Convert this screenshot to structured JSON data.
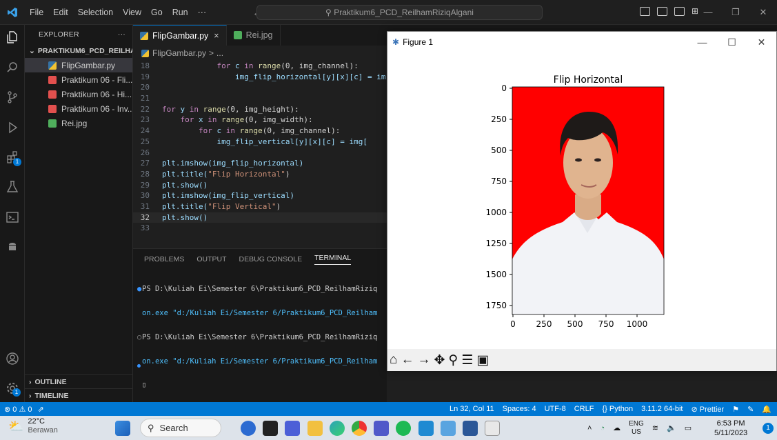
{
  "titlebar": {
    "menu": [
      "File",
      "Edit",
      "Selection",
      "View",
      "Go",
      "Run",
      "···"
    ],
    "search_text": "Praktikum6_PCD_ReilhamRiziqAlgani"
  },
  "activity_badges": {
    "extensions": "1",
    "accounts": "1"
  },
  "explorer": {
    "header": "EXPLORER",
    "more": "···",
    "folder": "PRAKTIKUM6_PCD_REILHA...",
    "files": [
      {
        "name": "FlipGambar.py",
        "color": "#f1c232"
      },
      {
        "name": "Praktikum 06 - Fli...",
        "color": "#e2504e"
      },
      {
        "name": "Praktikum 06 - Hi...",
        "color": "#e2504e"
      },
      {
        "name": "Praktikum 06 - Inv...",
        "color": "#e2504e"
      },
      {
        "name": "Rei.jpg",
        "color": "#4fae5c"
      }
    ],
    "outline": "OUTLINE",
    "timeline": "TIMELINE"
  },
  "editor": {
    "tabs": [
      {
        "label": "FlipGambar.py",
        "close": "×"
      },
      {
        "label": "Rei.jpg"
      }
    ],
    "breadcrumb": [
      "FlipGambar.py",
      ">",
      "..."
    ],
    "lines": [
      "18",
      "19",
      "20",
      "21",
      "22",
      "23",
      "24",
      "25",
      "26",
      "27",
      "28",
      "29",
      "30",
      "31",
      "32",
      "33"
    ],
    "code": {
      "l18_for": "for",
      "l18_c": "c",
      "l18_in": "in",
      "l18_range": "range",
      "l18_args": "(0, img_channel):",
      "l19": "img_flip_horizontal[y][x][c] = im",
      "l22_for": "for",
      "l22_y": "y",
      "l22_in": "in",
      "l22_range": "range",
      "l22_args": "(0, img_height):",
      "l23_for": "for",
      "l23_x": "x",
      "l23_in": "in",
      "l23_range": "range",
      "l23_args": "(0, img_width):",
      "l24_for": "for",
      "l24_c": "c",
      "l24_in": "in",
      "l24_range": "range",
      "l24_args": "(0, img_channel):",
      "l25": "img_flip_vertical[y][x][c] = img[",
      "l27": "plt.imshow(img_flip_horizontal)",
      "l28_a": "plt.title(",
      "l28_s": "\"Flip Horizontal\"",
      "l28_b": ")",
      "l29": "plt.show()",
      "l30": "plt.imshow(img_flip_vertical)",
      "l31_a": "plt.title(",
      "l31_s": "\"Flip Vertical\"",
      "l31_b": ")",
      "l32": "plt.show()"
    }
  },
  "panel": {
    "tabs": [
      "PROBLEMS",
      "OUTPUT",
      "DEBUG CONSOLE",
      "TERMINAL"
    ],
    "terminal": [
      "PS D:\\Kuliah Ei\\Semester 6\\Praktikum6_PCD_ReilhamRiziq",
      "on.exe \"d:/Kuliah Ei/Semester 6/Praktikum6_PCD_Reilham",
      "PS D:\\Kuliah Ei\\Semester 6\\Praktikum6_PCD_ReilhamRiziq",
      "on.exe \"d:/Kuliah Ei/Semester 6/Praktikum6_PCD_Reilham"
    ],
    "cursor": "▯"
  },
  "figure": {
    "window_title": "Figure 1",
    "plot_title": "Flip Horizontal",
    "y_ticks": [
      "0",
      "250",
      "500",
      "750",
      "1000",
      "1250",
      "1500",
      "1750"
    ],
    "x_ticks": [
      "0",
      "250",
      "500",
      "750",
      "1000"
    ],
    "toolbar": [
      "home-icon",
      "back-icon",
      "forward-icon",
      "pan-icon",
      "zoom-icon",
      "configure-icon",
      "save-icon"
    ]
  },
  "statusbar": {
    "errors": "⊗ 0 ⚠ 0",
    "right": [
      "Ln 32, Col 11",
      "Spaces: 4",
      "UTF-8",
      "CRLF",
      "{} Python",
      "3.11.2 64-bit",
      "⊘ Prettier"
    ]
  },
  "taskbar": {
    "temp": "22°C",
    "weather": "Berawan",
    "search": "Search",
    "lang_top": "ENG",
    "lang_bottom": "US",
    "time": "6:53 PM",
    "date": "5/11/2023",
    "notif": "1"
  },
  "colors": {
    "accent": "#0078d4",
    "image_bg": "#ff0000"
  }
}
